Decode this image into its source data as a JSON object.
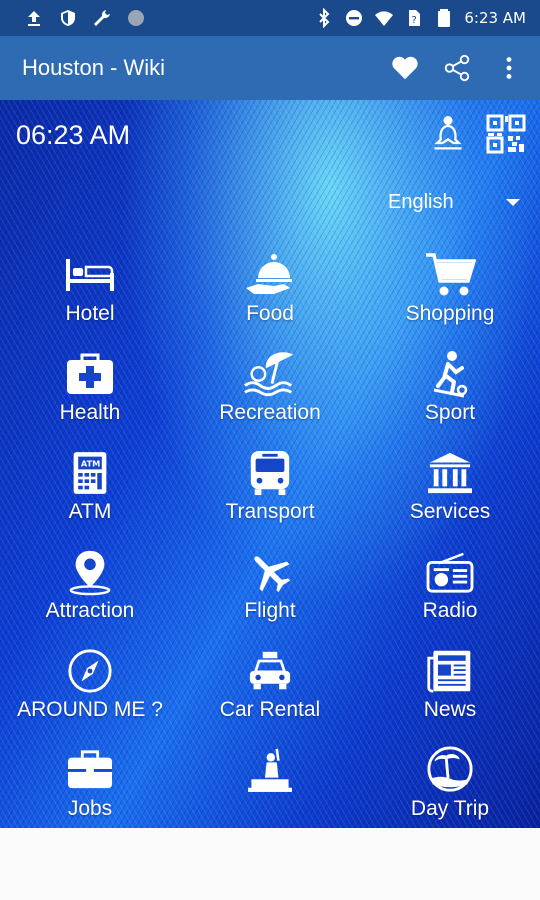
{
  "status_bar": {
    "time": "6:23 AM"
  },
  "app_bar": {
    "title": "Houston - Wiki"
  },
  "main": {
    "clock": "06:23 AM",
    "language": "English"
  },
  "categories": [
    {
      "label": "Hotel",
      "icon": "bed-icon"
    },
    {
      "label": "Food",
      "icon": "food-icon"
    },
    {
      "label": "Shopping",
      "icon": "cart-icon"
    },
    {
      "label": "Health",
      "icon": "first-aid-icon"
    },
    {
      "label": "Recreation",
      "icon": "beach-icon"
    },
    {
      "label": "Sport",
      "icon": "sport-icon"
    },
    {
      "label": "ATM",
      "icon": "atm-icon"
    },
    {
      "label": "Transport",
      "icon": "bus-icon"
    },
    {
      "label": "Services",
      "icon": "bank-icon"
    },
    {
      "label": "Attraction",
      "icon": "map-pin-icon"
    },
    {
      "label": "Flight",
      "icon": "plane-icon"
    },
    {
      "label": "Radio",
      "icon": "radio-icon"
    },
    {
      "label": "AROUND ME ?",
      "icon": "compass-icon"
    },
    {
      "label": "Car Rental",
      "icon": "taxi-icon"
    },
    {
      "label": "News",
      "icon": "newspaper-icon"
    },
    {
      "label": "Jobs",
      "icon": "briefcase-icon"
    },
    {
      "label": "",
      "icon": "statue-icon"
    },
    {
      "label": "Day Trip",
      "icon": "island-icon"
    }
  ]
}
